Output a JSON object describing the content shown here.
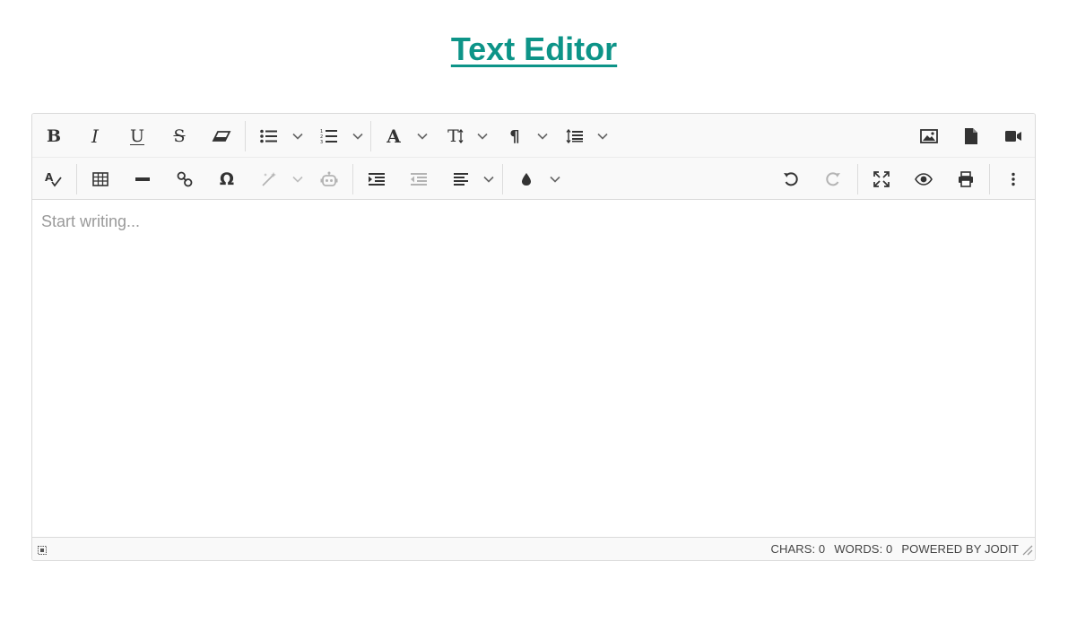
{
  "page": {
    "title": "Text Editor"
  },
  "toolbar": {
    "row1_left": [
      {
        "name": "bold-button",
        "icon": "bold-icon",
        "glyph": "B"
      },
      {
        "name": "italic-button",
        "icon": "italic-icon",
        "glyph": "I"
      },
      {
        "name": "underline-button",
        "icon": "underline-icon",
        "glyph": "U"
      },
      {
        "name": "strikethrough-button",
        "icon": "strikethrough-icon",
        "glyph": "S"
      },
      {
        "name": "eraser-button",
        "icon": "eraser-icon"
      },
      {
        "name": "unordered-list-button",
        "icon": "bulleted-list-icon",
        "has_dropdown": true
      },
      {
        "name": "ordered-list-button",
        "icon": "numbered-list-icon",
        "has_dropdown": true
      },
      {
        "name": "font-button",
        "icon": "font-icon",
        "glyph": "A",
        "has_dropdown": true
      },
      {
        "name": "font-size-button",
        "icon": "font-size-icon",
        "glyph": "T",
        "has_dropdown": true
      },
      {
        "name": "paragraph-button",
        "icon": "paragraph-icon",
        "glyph": "¶",
        "has_dropdown": true
      },
      {
        "name": "line-height-button",
        "icon": "line-height-icon",
        "has_dropdown": true
      }
    ],
    "row1_right": [
      {
        "name": "image-button",
        "icon": "image-icon"
      },
      {
        "name": "file-button",
        "icon": "file-icon"
      },
      {
        "name": "video-button",
        "icon": "video-icon"
      }
    ],
    "row2_left": [
      {
        "name": "spellcheck-button",
        "icon": "spellcheck-icon"
      },
      {
        "name": "table-button",
        "icon": "table-icon"
      },
      {
        "name": "horizontal-rule-button",
        "icon": "horizontal-rule-icon"
      },
      {
        "name": "link-button",
        "icon": "link-icon"
      },
      {
        "name": "special-characters-button",
        "icon": "omega-icon",
        "glyph": "Ω"
      },
      {
        "name": "ai-commands-button",
        "icon": "magic-wand-icon",
        "has_dropdown": true,
        "disabled": true
      },
      {
        "name": "ai-assistant-button",
        "icon": "robot-icon",
        "disabled": true
      },
      {
        "name": "indent-button",
        "icon": "indent-icon"
      },
      {
        "name": "outdent-button",
        "icon": "outdent-icon",
        "disabled": true
      },
      {
        "name": "align-button",
        "icon": "align-left-icon",
        "has_dropdown": true
      },
      {
        "name": "brush-button",
        "icon": "color-drop-icon",
        "has_dropdown": true
      }
    ],
    "row2_right": [
      {
        "name": "undo-button",
        "icon": "undo-icon"
      },
      {
        "name": "redo-button",
        "icon": "redo-icon",
        "disabled": true
      },
      {
        "name": "fullsize-button",
        "icon": "fullscreen-icon"
      },
      {
        "name": "preview-button",
        "icon": "eye-icon"
      },
      {
        "name": "print-button",
        "icon": "print-icon"
      },
      {
        "name": "more-button",
        "icon": "more-vertical-icon"
      }
    ]
  },
  "editor": {
    "placeholder": "Start writing..."
  },
  "statusbar": {
    "source_icon": "source-code-icon",
    "chars": "CHARS: 0",
    "words": "WORDS: 0",
    "powered_by": "POWERED BY JODIT",
    "resize_icon": "resize-handle-icon"
  },
  "colors": {
    "title": "#0d9488",
    "icon": "#333333",
    "disabled_icon": "#b5b5b5",
    "toolbar_bg": "#f9f9f9",
    "border": "#dadada",
    "placeholder": "#9a9a9a"
  }
}
